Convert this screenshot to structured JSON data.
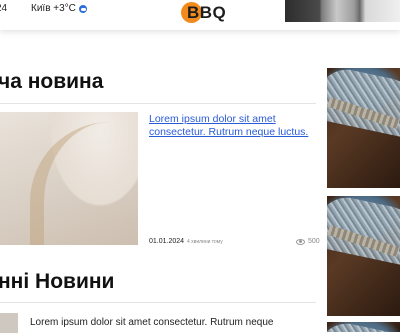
{
  "header": {
    "time": "24",
    "weather_text": "Київ +3°C",
    "logo_text": "BBQ"
  },
  "section1": {
    "title": "ча новина",
    "article": {
      "link_line1": "Lorem ipsum dolor sit amet",
      "link_line2": "consectetur. Rutrum neque luctus.",
      "date": "01.01.2024",
      "ago": "4 хвилини тому",
      "views": "500"
    }
  },
  "section2": {
    "title": "нні Новини",
    "snippet": "Lorem ipsum dolor sit amet consectetur. Rutrum neque"
  },
  "icons": {
    "weather": "cloud-icon",
    "views": "eye-icon"
  },
  "colors": {
    "link": "#2a5bd7",
    "logo_accent": "#f28b1c"
  }
}
